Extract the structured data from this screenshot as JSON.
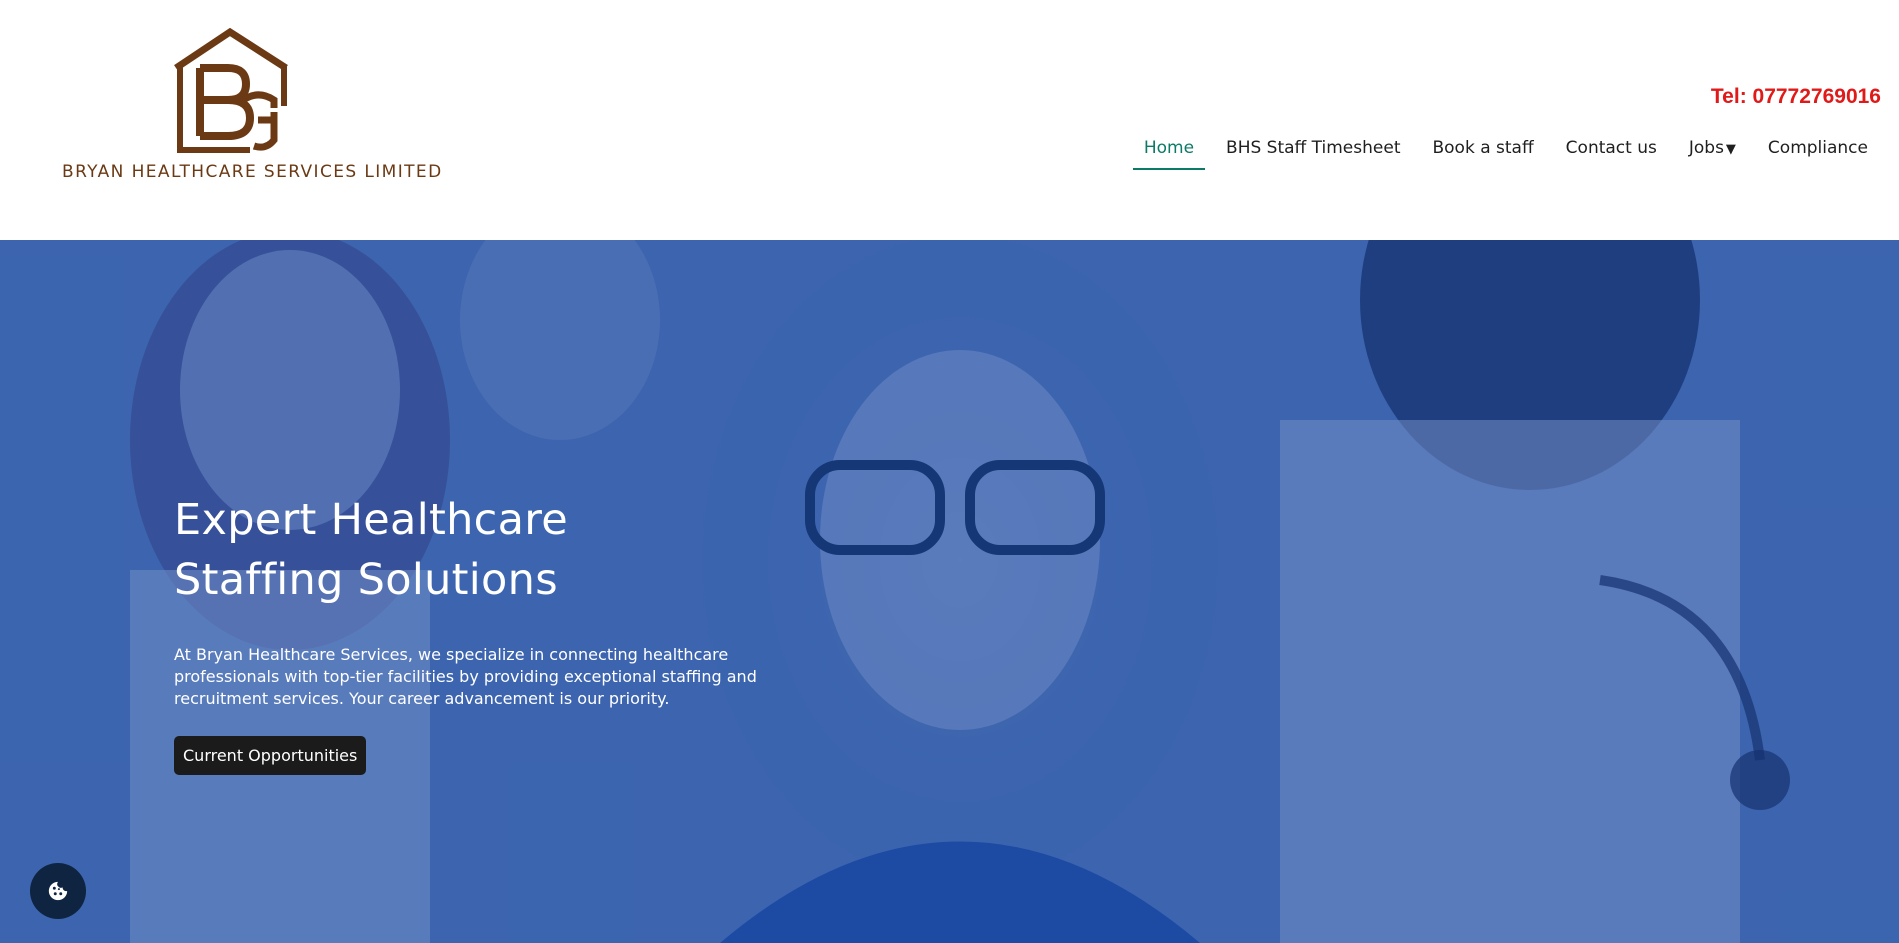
{
  "brand": {
    "name": "BRYAN HEALTHCARE SERVICES LIMITED",
    "monogram": "BRG",
    "logo_color": "#6b3a14"
  },
  "header": {
    "tel": "Tel: 07772769016",
    "tel_color": "#e01919"
  },
  "nav": {
    "items": [
      {
        "label": "Home",
        "active": true
      },
      {
        "label": "BHS Staff Timesheet",
        "active": false
      },
      {
        "label": "Book a staff",
        "active": false
      },
      {
        "label": "Contact us",
        "active": false
      },
      {
        "label": "Jobs",
        "active": false,
        "has_dropdown": true,
        "caret_icon": "caret-down-icon"
      },
      {
        "label": "Compliance",
        "active": false
      }
    ],
    "active_color": "#0d7a67"
  },
  "hero": {
    "title": "Expert Healthcare Staffing Solutions",
    "text": "At Bryan Healthcare Services, we specialize in connecting healthcare professionals with top-tier facilities by providing exceptional staffing and recruitment services. Your career advancement is our priority.",
    "button_label": "Current Opportunities",
    "overlay_color": "#1242a0",
    "background": "photo of smiling healthcare workers"
  },
  "cookie": {
    "icon": "cookie-icon"
  }
}
